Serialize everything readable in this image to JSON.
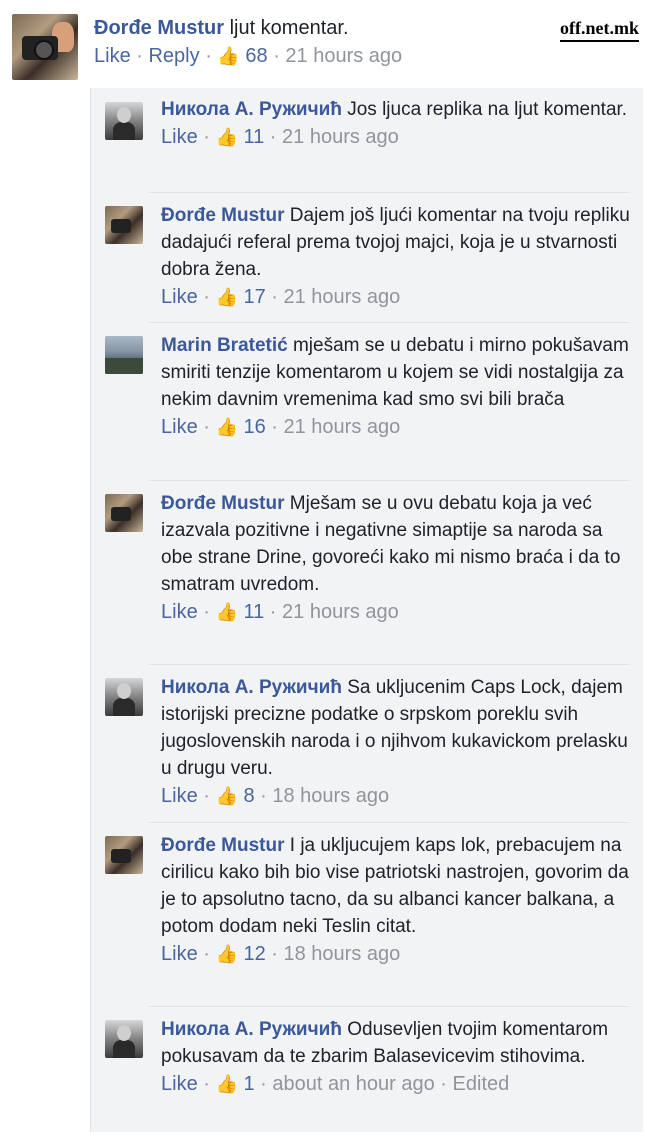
{
  "watermark": "off.net.mk",
  "top_comment": {
    "author": "Đorđe Mustur",
    "text": "ljut komentar.",
    "like": "Like",
    "reply": "Reply",
    "likes": "68",
    "time": "21 hours ago"
  },
  "replies": [
    {
      "author": "Никола А. Ружичић",
      "text": "Jos ljuca replika na ljut komentar.",
      "like": "Like",
      "likes": "11",
      "time": "21 hours ago",
      "edited": ""
    },
    {
      "author": "Đorđe Mustur",
      "text": "Dajem još ljući komentar na tvoju repliku dadajući referal prema tvojoj majci, koja je u stvarnosti dobra žena.",
      "like": "Like",
      "likes": "17",
      "time": "21 hours ago",
      "edited": ""
    },
    {
      "author": "Marin Bratetić",
      "text": "mješam se u debatu i mirno pokušavam smiriti tenzije komentarom u kojem se vidi nostalgija za nekim davnim vremenima kad smo svi bili brača",
      "like": "Like",
      "likes": "16",
      "time": "21 hours ago",
      "edited": ""
    },
    {
      "author": "Đorđe Mustur",
      "text": "Mješam se u ovu debatu koja ja već izazvala pozitivne i negativne simaptije sa naroda sa obe strane Drine, govoreći kako mi nismo braća i da to smatram uvredom.",
      "like": "Like",
      "likes": "11",
      "time": "21 hours ago",
      "edited": ""
    },
    {
      "author": "Никола А. Ружичић",
      "text": "Sa ukljucenim Caps Lock, dajem istorijski precizne podatke o srpskom poreklu svih jugoslovenskih naroda i o njihvom kukavickom prelasku u drugu veru.",
      "like": "Like",
      "likes": "8",
      "time": "18 hours ago",
      "edited": ""
    },
    {
      "author": "Đorđe Mustur",
      "text": "I ja ukljucujem kaps lok, prebacujem na cirilicu kako bih bio vise patriotski nastrojen, govorim da je to apsolutno tacno, da su albanci kancer balkana, a potom dodam neki Teslin citat.",
      "like": "Like",
      "likes": "12",
      "time": "18 hours ago",
      "edited": ""
    },
    {
      "author": "Никола А. Ружичић",
      "text": "Odusevljen tvojim komentarom pokusavam da te zbarim Balasevicevim stihovima.",
      "like": "Like",
      "likes": "1",
      "time": "about an hour ago",
      "edited": "Edited"
    }
  ]
}
